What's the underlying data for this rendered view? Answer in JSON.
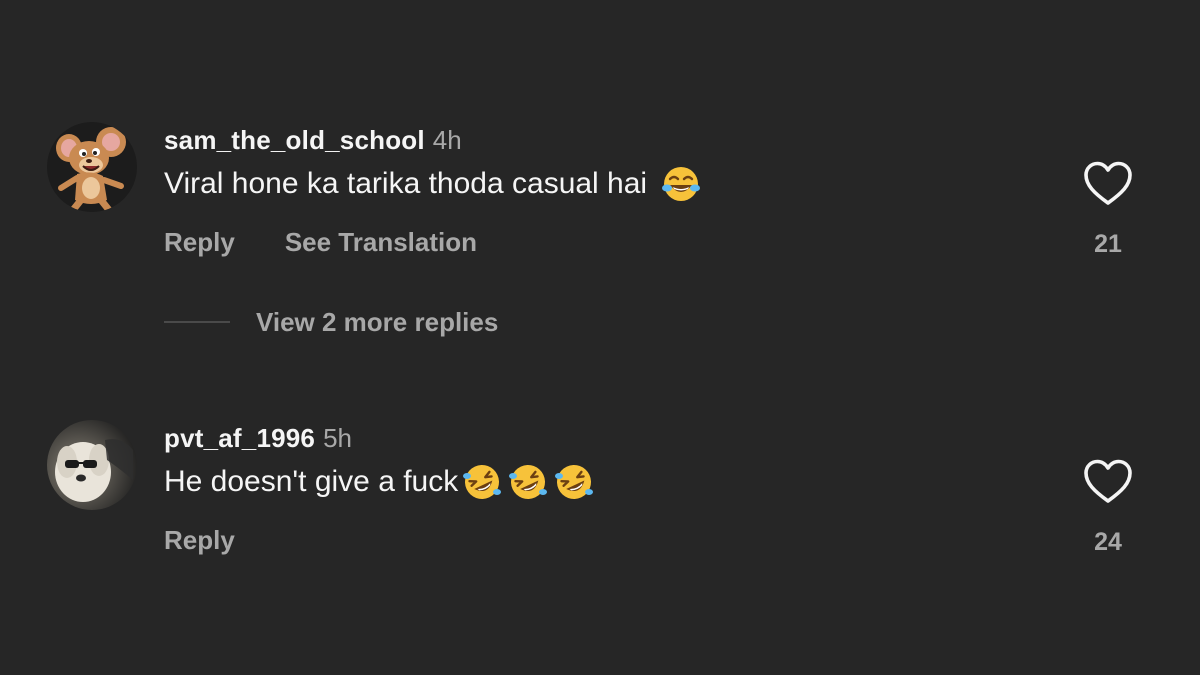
{
  "comments": [
    {
      "username": "sam_the_old_school",
      "time": "4h",
      "text": "Viral hone ka tarika thoda casual hai",
      "emojis": [
        "face-with-tears-of-joy"
      ],
      "actions": {
        "reply": "Reply",
        "translate": "See Translation"
      },
      "likes": "21",
      "view_replies": "View 2 more replies"
    },
    {
      "username": "pvt_af_1996",
      "time": "5h",
      "text": "He doesn't give a fuck",
      "emojis": [
        "rolling-on-the-floor-laughing",
        "rolling-on-the-floor-laughing",
        "rolling-on-the-floor-laughing"
      ],
      "actions": {
        "reply": "Reply"
      },
      "likes": "24"
    }
  ],
  "colors": {
    "background": "#262626",
    "primary_text": "#f5f5f5",
    "secondary_text": "#a8a8a8",
    "emoji_yellow": "#f7c23a"
  },
  "icons": [
    "heart-outline-icon",
    "avatar-cartoon-mouse",
    "avatar-dog-sunglasses"
  ]
}
